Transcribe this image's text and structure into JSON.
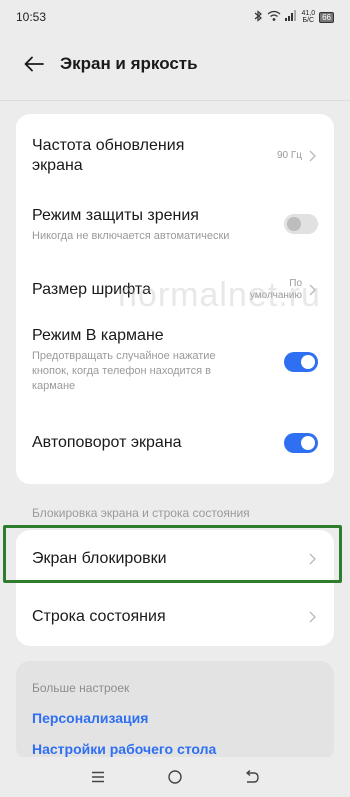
{
  "status_bar": {
    "time": "10:53",
    "speed_value": "41,0",
    "speed_unit": "Б/С",
    "battery": "66"
  },
  "header": {
    "title": "Экран и яркость"
  },
  "main_card": {
    "items": [
      {
        "title": "Частота обновления экрана",
        "value": "90 Гц"
      },
      {
        "title": "Режим защиты зрения",
        "subtitle": "Никогда не включается автоматически",
        "toggle": "off"
      },
      {
        "title": "Размер шрифта",
        "value": "По умолчанию"
      },
      {
        "title": "Режим В кармане",
        "subtitle": "Предотвращать случайное нажатие кнопок, когда телефон находится в кармане",
        "toggle": "on"
      },
      {
        "title": "Автоповорот экрана",
        "toggle": "on"
      }
    ]
  },
  "lock_section": {
    "label": "Блокировка экрана и строка состояния",
    "items": [
      {
        "title": "Экран блокировки"
      },
      {
        "title": "Строка состояния"
      }
    ]
  },
  "more_settings": {
    "title": "Больше настроек",
    "links": [
      "Персонализация",
      "Настройки рабочего стола"
    ]
  },
  "watermark": "normalnet.ru",
  "colors": {
    "accent": "#2f6ff2",
    "highlight": "#2e7d2e",
    "background": "#ececec"
  }
}
